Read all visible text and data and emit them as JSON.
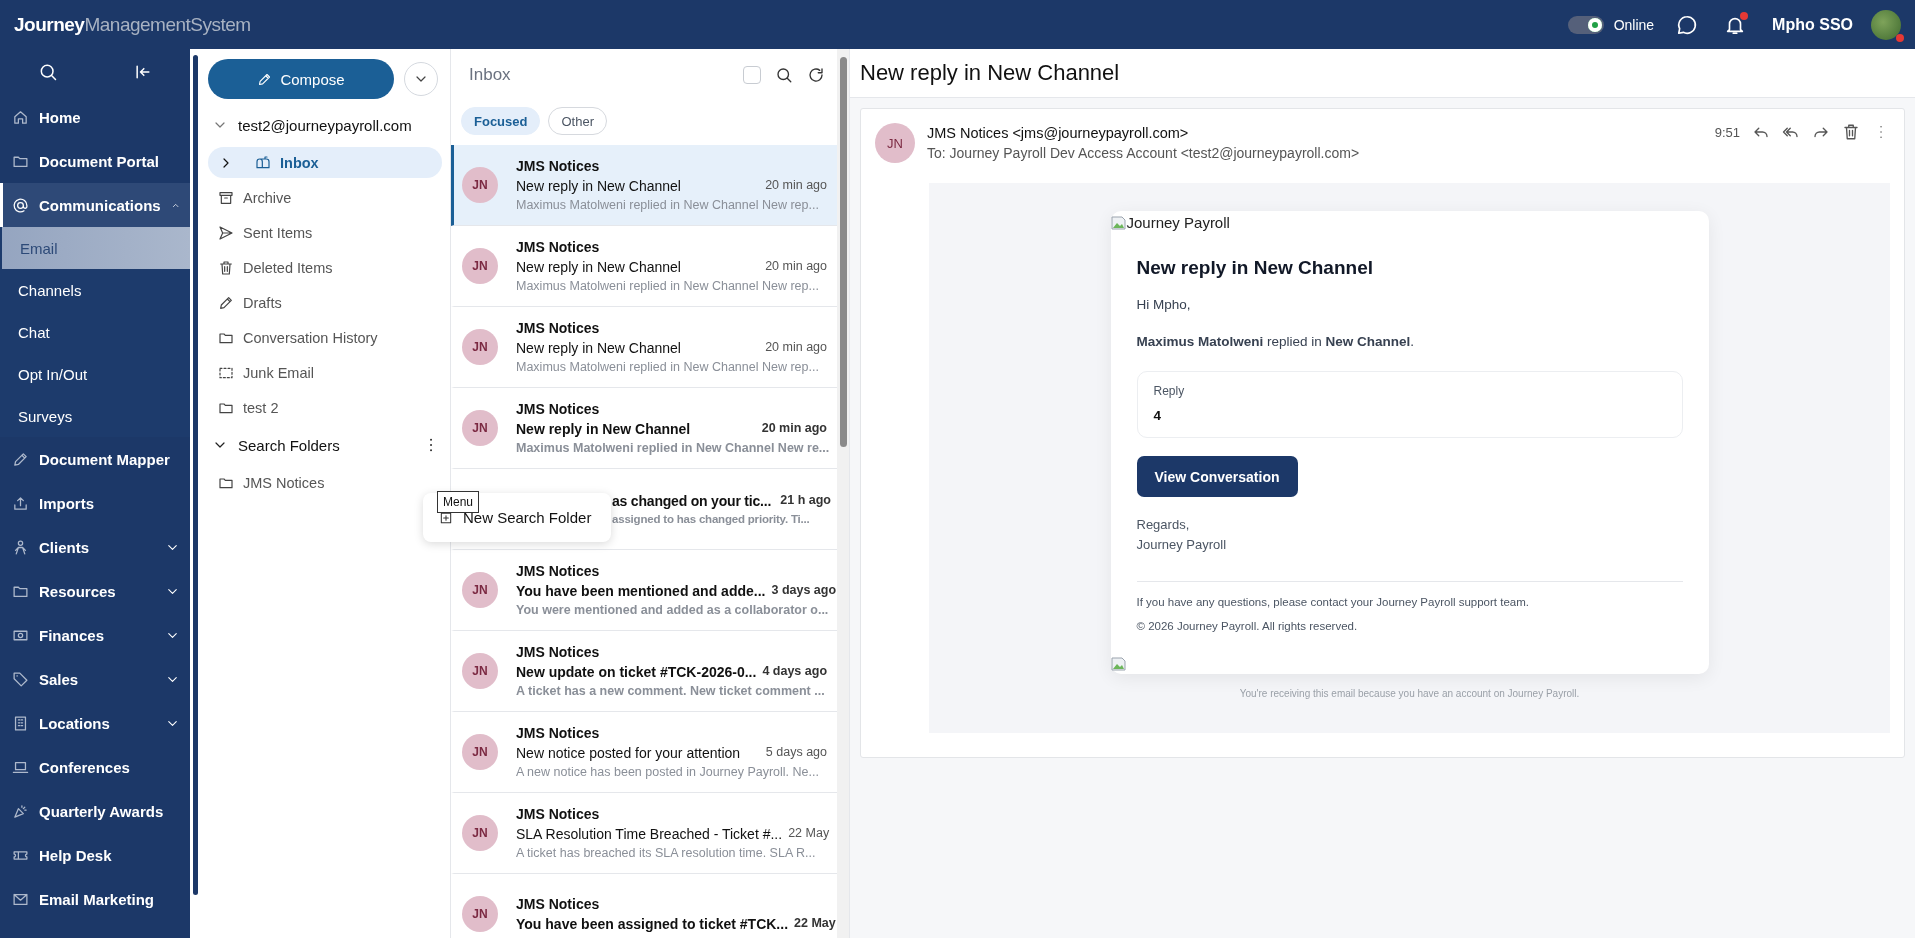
{
  "top_bar": {
    "logo": {
      "bold_part": "Journey",
      "light_part": "ManagementSystem"
    },
    "presence": {
      "on": true,
      "label": "Online"
    },
    "notifications": {
      "unread": true
    },
    "user": {
      "name": "Mpho SSO",
      "alert": true
    }
  },
  "sidebar": {
    "items": [
      {
        "label": "Home",
        "kind": "link",
        "selected": false
      },
      {
        "label": "Document Portal",
        "kind": "link",
        "selected": false
      },
      {
        "label": "Communications",
        "kind": "group",
        "expanded": true,
        "selected": true,
        "children": [
          {
            "label": "Email",
            "selected": true
          },
          {
            "label": "Channels",
            "selected": false
          },
          {
            "label": "Chat",
            "selected": false
          },
          {
            "label": "Opt In/Out",
            "selected": false
          },
          {
            "label": "Surveys",
            "selected": false
          }
        ]
      },
      {
        "label": "Document Mapper",
        "kind": "link",
        "selected": false
      },
      {
        "label": "Imports",
        "kind": "link",
        "selected": false
      },
      {
        "label": "Clients",
        "kind": "group",
        "expanded": false,
        "selected": false
      },
      {
        "label": "Resources",
        "kind": "group",
        "expanded": false,
        "selected": false
      },
      {
        "label": "Finances",
        "kind": "group",
        "expanded": false,
        "selected": false
      },
      {
        "label": "Sales",
        "kind": "group",
        "expanded": false,
        "selected": false
      },
      {
        "label": "Locations",
        "kind": "group",
        "expanded": false,
        "selected": false
      },
      {
        "label": "Conferences",
        "kind": "link",
        "selected": false
      },
      {
        "label": "Quarterly Awards",
        "kind": "link",
        "selected": false
      },
      {
        "label": "Help Desk",
        "kind": "link",
        "selected": false
      },
      {
        "label": "Email Marketing",
        "kind": "link",
        "selected": false
      }
    ]
  },
  "folders": {
    "compose": "Compose",
    "account": {
      "label": "test2@journeypayroll.com",
      "expanded": true
    },
    "items": [
      {
        "label": "Inbox",
        "selected": true,
        "expanded": false
      },
      {
        "label": "Archive",
        "selected": false
      },
      {
        "label": "Sent Items",
        "selected": false
      },
      {
        "label": "Deleted Items",
        "selected": false
      },
      {
        "label": "Drafts",
        "selected": false
      },
      {
        "label": "Conversation History",
        "selected": false
      },
      {
        "label": "Junk Email",
        "selected": false
      },
      {
        "label": "test 2",
        "selected": false
      }
    ],
    "search_folders": {
      "label": "Search Folders",
      "expanded": true,
      "children": [
        {
          "label": "JMS Notices",
          "selected": false
        }
      ]
    },
    "tooltip": "Menu",
    "menu": [
      "New Search Folder"
    ]
  },
  "message_list": {
    "title": "Inbox",
    "select_all": {
      "checked": false
    },
    "tabs": [
      {
        "label": "Focused",
        "selected": true
      },
      {
        "label": "Other",
        "selected": false
      }
    ],
    "messages": [
      {
        "kind": "full",
        "initials": "JN",
        "sender": "JMS Notices",
        "subject": "New reply in New Channel",
        "time": "20 min ago",
        "preview": "Maximus Matolweni replied in New Channel New rep...",
        "unread": false,
        "selected": true
      },
      {
        "kind": "full",
        "initials": "JN",
        "sender": "JMS Notices",
        "subject": "New reply in New Channel",
        "time": "20 min ago",
        "preview": "Maximus Matolweni replied in New Channel New rep...",
        "unread": false,
        "selected": false
      },
      {
        "kind": "full",
        "initials": "JN",
        "sender": "JMS Notices",
        "subject": "New reply in New Channel",
        "time": "20 min ago",
        "preview": "Maximus Matolweni replied in New Channel New rep...",
        "unread": false,
        "selected": false
      },
      {
        "kind": "full",
        "initials": "JN",
        "sender": "JMS Notices",
        "subject": "New reply in New Channel",
        "time": "20 min ago",
        "preview": "Maximus Matolweni replied in New Channel New re...",
        "unread": true,
        "selected": false
      },
      {
        "kind": "covered",
        "subject": "as changed on your tic...",
        "time": "21 h ago",
        "preview": "assigned to has changed priority. Ti...",
        "unread": true,
        "selected": false
      },
      {
        "kind": "full",
        "initials": "JN",
        "sender": "JMS Notices",
        "subject": "You have been mentioned and adde...",
        "time": "3 days ago",
        "preview": "You were mentioned and added as a collaborator o...",
        "unread": true,
        "selected": false
      },
      {
        "kind": "full",
        "initials": "JN",
        "sender": "JMS Notices",
        "subject": "New update on ticket #TCK-2026-0...",
        "time": "4 days ago",
        "preview": "A ticket has a new comment. New ticket comment ...",
        "unread": true,
        "selected": false
      },
      {
        "kind": "full",
        "initials": "JN",
        "sender": "JMS Notices",
        "subject": "New notice posted for your attention",
        "time": "5 days ago",
        "preview": "A new notice has been posted in Journey Payroll. Ne...",
        "unread": false,
        "selected": false
      },
      {
        "kind": "full",
        "initials": "JN",
        "sender": "JMS Notices",
        "subject": "SLA Resolution Time Breached - Ticket #...",
        "time": "22 May",
        "preview": "A ticket has breached its SLA resolution time. SLA R...",
        "unread": false,
        "selected": false
      },
      {
        "kind": "full",
        "initials": "JN",
        "sender": "JMS Notices",
        "subject": "You have been assigned to ticket #TCK...",
        "time": "22 May",
        "unread": true,
        "selected": false
      }
    ]
  },
  "reading_pane": {
    "title": "New reply in New Channel",
    "initials": "JN",
    "from": "JMS Notices <jms@journeypayroll.com>",
    "to": "To: Journey Payroll Dev Access Account <test2@journeypayroll.com>",
    "time": "9:51",
    "email": {
      "image_alt": "Journey Payroll",
      "heading": "New reply in New Channel",
      "greeting": "Hi Mpho,",
      "body": "**Maximus Matolweni** replied in **New Channel**.",
      "reply_label": "Reply",
      "reply_value": "4",
      "button": "View Conversation",
      "signoff": [
        "Regards,",
        "Journey Payroll"
      ],
      "footer": [
        "If you have any questions, please contact your Journey Payroll support team.",
        "© 2026 Journey Payroll. All rights reserved."
      ],
      "notice": "You're receiving this email because you have an account on Journey Payroll."
    }
  }
}
